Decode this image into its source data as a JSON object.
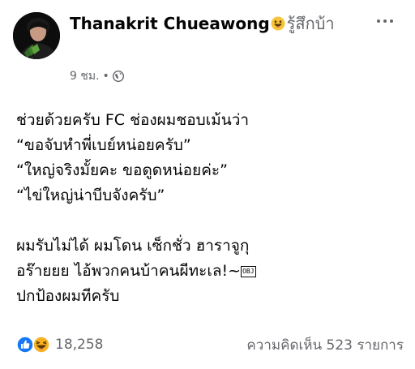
{
  "post": {
    "author_name": "Thanakrit Chueawong",
    "feeling_text": "รู้สึกบ้า",
    "feeling_icon": "grinning-face-emoji",
    "timestamp": "9 ชม.",
    "separator": "•",
    "audience_icon": "globe-icon",
    "body_lines": [
      "ช่วยด้วยครับ FC ช่องผมชอบเม้นว่า",
      "“ขอจับหำพี่เบย์หน่อยครับ”",
      "“ใหญ่จริงมั้ยคะ ขอดูดหน่อยค่ะ”",
      "“ไข่ใหญ่น่าบีบจังครับ”",
      "",
      "ผมรับไม่ได้ ผมโดน เซ็กชั่ว ฮาราจูกุ",
      "อร๊ายยย ไอ้พวกคนบ้าคนผีทะเล!~",
      "ปกป้องผมทีครับ"
    ],
    "obj_glyph": "OBJ",
    "reactions": {
      "icons": [
        "like-reaction-icon",
        "haha-reaction-icon"
      ],
      "count": "18,258"
    },
    "comments_label": "ความคิดเห็น 523 รายการ",
    "colors": {
      "text_primary": "#050505",
      "text_secondary": "#65676b",
      "like_blue": "#1877f2",
      "haha_yellow": "#f7b125"
    }
  }
}
